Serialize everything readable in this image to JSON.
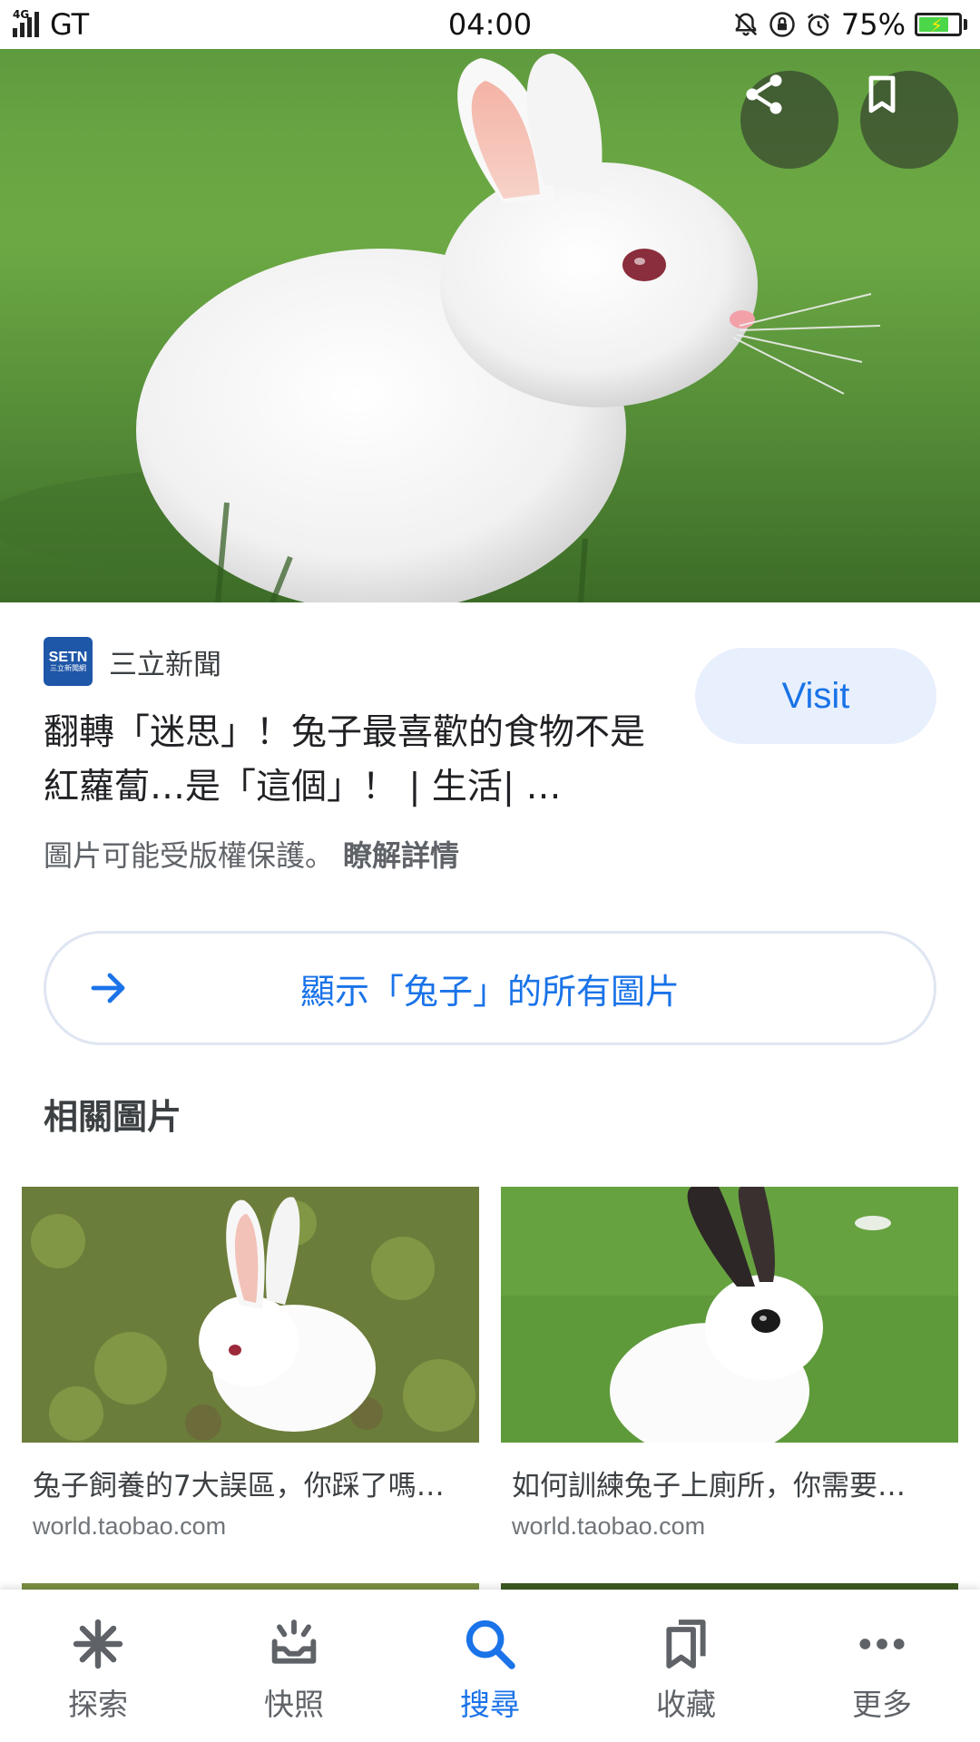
{
  "status_bar": {
    "network": "4G",
    "carrier": "GT",
    "time": "04:00",
    "battery": "75%"
  },
  "hero": {
    "share_icon": "share-icon",
    "save_icon": "bookmark-icon"
  },
  "result": {
    "source_logo_text": "SETN",
    "source_logo_sub": "三立新聞網",
    "source_name": "三立新聞",
    "title": "翻轉「迷思」！兔子最喜歡的食物不是紅蘿蔔…是「這個」！ | 生活| …",
    "visit_label": "Visit",
    "copyright_text": "圖片可能受版權保護。",
    "learn_more": "瞭解詳情"
  },
  "show_all": {
    "label": "顯示「兔子」的所有圖片",
    "icon": "arrow-right-icon"
  },
  "related": {
    "heading": "相關圖片",
    "items": [
      {
        "title": "兔子飼養的7大誤區，你踩了嗎…",
        "url": "world.taobao.com"
      },
      {
        "title": "如何訓練兔子上廁所，你需要…",
        "url": "world.taobao.com"
      }
    ]
  },
  "bottom_nav": [
    {
      "label": "探索",
      "icon": "asterisk-icon",
      "active": false
    },
    {
      "label": "快照",
      "icon": "snapshot-icon",
      "active": false
    },
    {
      "label": "搜尋",
      "icon": "search-icon",
      "active": true
    },
    {
      "label": "收藏",
      "icon": "collections-icon",
      "active": false
    },
    {
      "label": "更多",
      "icon": "more-icon",
      "active": false
    }
  ],
  "colors": {
    "accent": "#1a73e8",
    "visit_bg": "#e8f0fe",
    "text_secondary": "#5f6368"
  }
}
